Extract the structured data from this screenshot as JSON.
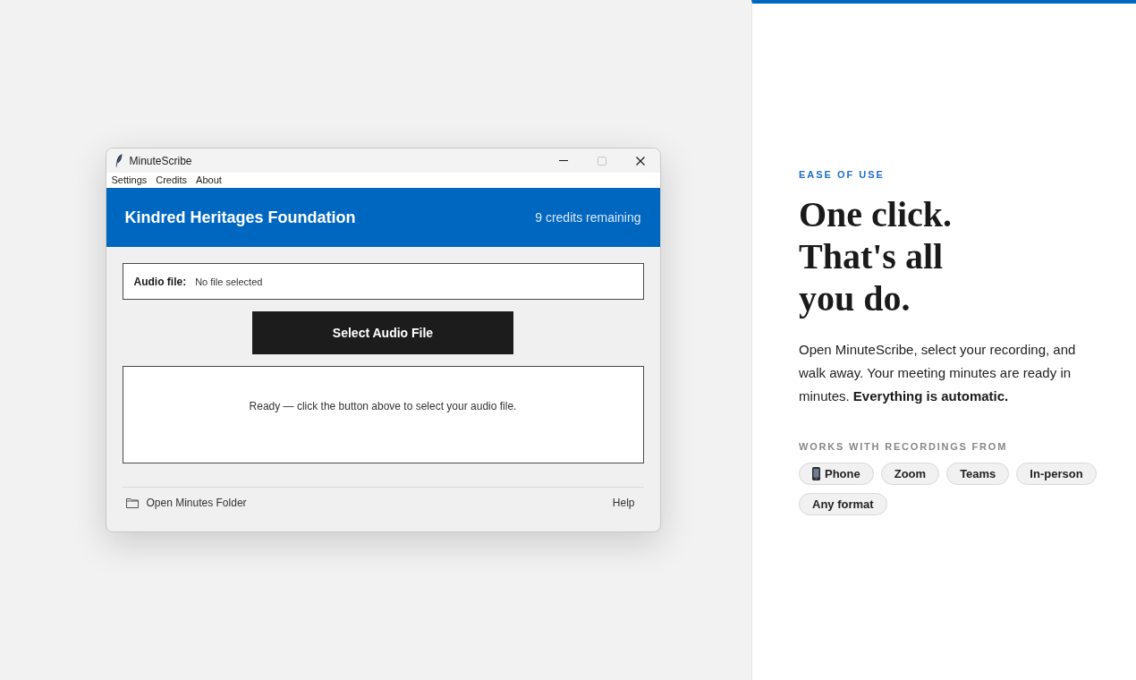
{
  "app_window": {
    "title": "MinuteScribe",
    "controls": [
      {
        "kind": "minimize",
        "disabled": false
      },
      {
        "kind": "maximize",
        "disabled": true
      },
      {
        "kind": "close",
        "disabled": false
      }
    ],
    "menu": [
      "Settings",
      "Credits",
      "About"
    ],
    "header": {
      "organization": "Kindred Heritages Foundation",
      "credits": "9 credits remaining"
    },
    "audio_file": {
      "label": "Audio file:",
      "value": "No file selected"
    },
    "select_button": "Select Audio File",
    "status_message": "Ready — click the button above to select your audio file.",
    "footer": {
      "folder_link": "Open Minutes Folder",
      "help_link": "Help"
    }
  },
  "feature_panel": {
    "eyebrow": "EASE OF USE",
    "headline": "One click. That's all you do.",
    "description": "Open MinuteScribe, select your recording, and walk away. Your meeting minutes are ready in minutes. **Everything is automatic.**",
    "sources_label": "WORKS WITH RECORDINGS FROM",
    "sources": [
      {
        "label": "Phone",
        "kind": "icon"
      },
      {
        "label": "Zoom",
        "kind": "plain"
      },
      {
        "label": "Teams",
        "kind": "plain"
      },
      {
        "label": "In-person",
        "kind": "plain"
      },
      {
        "label": "Any format",
        "kind": "plain"
      }
    ]
  }
}
